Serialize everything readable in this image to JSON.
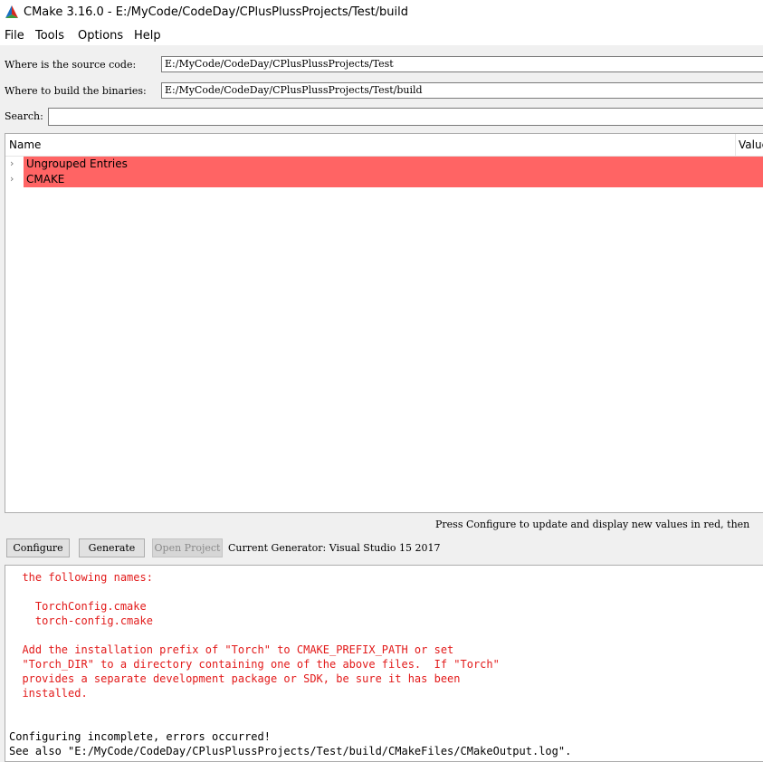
{
  "window": {
    "title": "CMake 3.16.0 - E:/MyCode/CodeDay/CPlusPlussProjects/Test/build"
  },
  "menu": [
    "File",
    "Tools",
    "Options",
    "Help"
  ],
  "source": {
    "label": "Where is the source code:",
    "value": "E:/MyCode/CodeDay/CPlusPlussProjects/Test"
  },
  "build": {
    "label": "Where to build the binaries:",
    "value": "E:/MyCode/CodeDay/CPlusPlussProjects/Test/build"
  },
  "search": {
    "label": "Search:",
    "value": ""
  },
  "tree": {
    "columns": {
      "name": "Name",
      "value": "Value"
    },
    "rows": [
      {
        "label": "Ungrouped Entries",
        "arrow": "›"
      },
      {
        "label": "CMAKE",
        "arrow": "›"
      }
    ]
  },
  "hint": "Press Configure to update and display new values in red,  then",
  "buttons": {
    "configure": "Configure",
    "generate": "Generate",
    "open_project": "Open Project"
  },
  "generator": "Current Generator: Visual Studio 15 2017",
  "output": {
    "lines": [
      {
        "text": "  the following names:",
        "color": "red"
      },
      {
        "text": "",
        "color": "red"
      },
      {
        "text": "    TorchConfig.cmake",
        "color": "red"
      },
      {
        "text": "    torch-config.cmake",
        "color": "red"
      },
      {
        "text": "",
        "color": "red"
      },
      {
        "text": "  Add the installation prefix of \"Torch\" to CMAKE_PREFIX_PATH or set",
        "color": "red"
      },
      {
        "text": "  \"Torch_DIR\" to a directory containing one of the above files.  If \"Torch\"",
        "color": "red"
      },
      {
        "text": "  provides a separate development package or SDK, be sure it has been",
        "color": "red"
      },
      {
        "text": "  installed.",
        "color": "red"
      },
      {
        "text": "",
        "color": "red"
      },
      {
        "text": "",
        "color": "red"
      },
      {
        "text": "Configuring incomplete, errors occurred!",
        "color": "black"
      },
      {
        "text": "See also \"E:/MyCode/CodeDay/CPlusPlussProjects/Test/build/CMakeFiles/CMakeOutput.log\".",
        "color": "black"
      }
    ]
  }
}
